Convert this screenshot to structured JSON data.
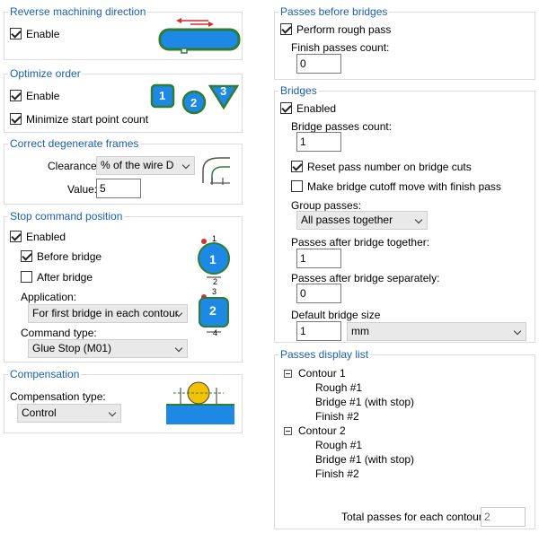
{
  "reverse": {
    "title": "Reverse machining direction",
    "enable_label": "Enable",
    "enable_checked": true
  },
  "optimize": {
    "title": "Optimize order",
    "enable_label": "Enable",
    "enable_checked": true,
    "minimize_label": "Minimize start point count",
    "minimize_checked": true,
    "badges": [
      "1",
      "2",
      "3"
    ]
  },
  "degenerate": {
    "title": "Correct degenerate frames",
    "clearance_label": "Clearance:",
    "clearance_value": "% of the wire D",
    "value_label": "Value:",
    "value": "5"
  },
  "stop": {
    "title": "Stop command position",
    "enabled_label": "Enabled",
    "enabled_checked": true,
    "before_label": "Before bridge",
    "before_checked": true,
    "after_label": "After bridge",
    "after_checked": false,
    "application_label": "Application:",
    "application_value": "For first bridge in each contour",
    "command_label": "Command type:",
    "command_value": "Glue Stop (M01)",
    "diagram_numbers": [
      "1",
      "1",
      "2",
      "3",
      "2",
      "4"
    ]
  },
  "compensation": {
    "title": "Compensation",
    "type_label": "Compensation type:",
    "type_value": "Control"
  },
  "passes_before": {
    "title": "Passes before bridges",
    "rough_label": "Perform rough pass",
    "rough_checked": true,
    "finish_label": "Finish passes count:",
    "finish_value": "0"
  },
  "bridges": {
    "title": "Bridges",
    "enabled_label": "Enabled",
    "enabled_checked": true,
    "count_label": "Bridge passes count:",
    "count_value": "1",
    "reset_label": "Reset pass number on bridge cuts",
    "reset_checked": true,
    "cutoff_label": "Make bridge cutoff move with finish pass",
    "cutoff_checked": false,
    "group_label": "Group passes:",
    "group_value": "All passes together",
    "together_label": "Passes after bridge together:",
    "together_value": "1",
    "separately_label": "Passes after bridge separately:",
    "separately_value": "0",
    "size_label": "Default bridge size",
    "size_value": "1",
    "unit_value": "mm"
  },
  "display": {
    "title": "Passes display list",
    "tree": [
      {
        "level": 0,
        "text": "Contour 1"
      },
      {
        "level": 1,
        "text": "Rough #1"
      },
      {
        "level": 1,
        "text": "Bridge #1 (with stop)"
      },
      {
        "level": 1,
        "text": "Finish #2"
      },
      {
        "level": 0,
        "text": "Contour 2"
      },
      {
        "level": 1,
        "text": "Rough #1"
      },
      {
        "level": 1,
        "text": "Bridge #1 (with stop)"
      },
      {
        "level": 1,
        "text": "Finish #2"
      }
    ],
    "total_label": "Total passes for each contour:",
    "total_value": "2"
  },
  "colors": {
    "group_title": "#1a5fb4",
    "icon_blue": "#1e88e5",
    "icon_green": "#2e7d32",
    "arrow_red": "#d32f2f",
    "ball_yellow": "#f2c200"
  }
}
